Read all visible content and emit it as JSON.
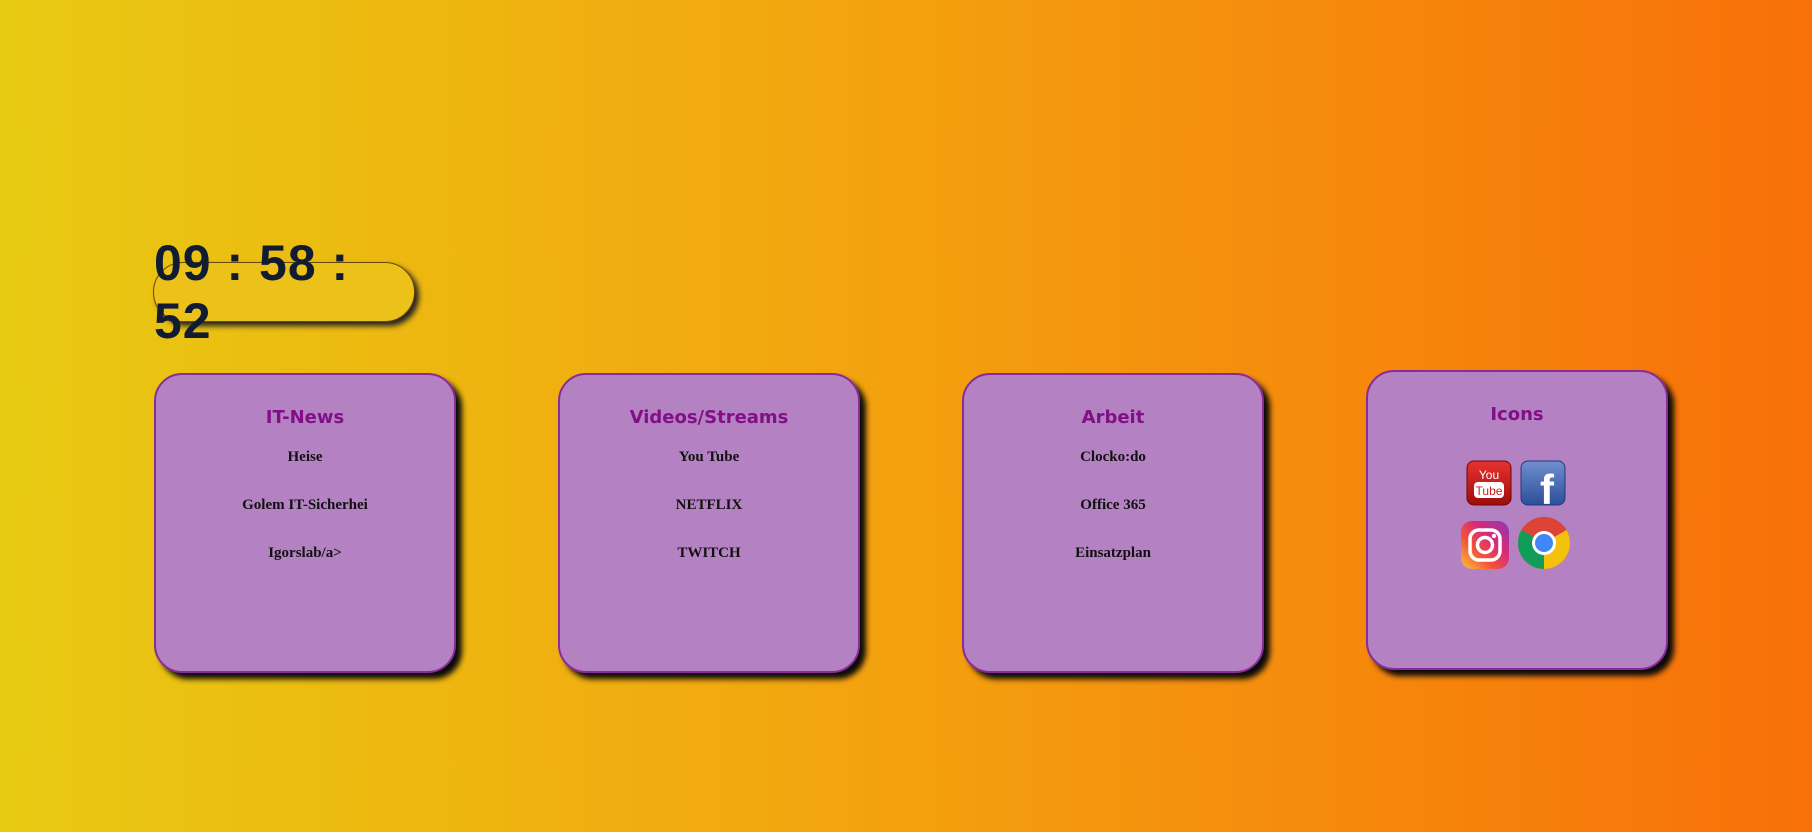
{
  "clock": {
    "time": "09 : 58 : 52"
  },
  "cards": [
    {
      "title": "IT-News",
      "links": [
        "Heise",
        "Golem IT-Sicherhei",
        "Igorslab/a>"
      ]
    },
    {
      "title": "Videos/Streams",
      "links": [
        "You Tube",
        "NETFLIX",
        "TWITCH"
      ]
    },
    {
      "title": "Arbeit",
      "links": [
        "Clocko:do",
        "Office 365",
        "Einsatzplan"
      ]
    },
    {
      "title": "Icons"
    }
  ],
  "icons": [
    "youtube-icon",
    "facebook-icon",
    "instagram-icon",
    "chrome-icon"
  ],
  "icon_text": {
    "youtube_top": "You",
    "youtube_bottom": "Tube",
    "facebook_letter": "f"
  },
  "colors": {
    "background_left": "#e8ca12",
    "background_right": "#f8700a",
    "card_bg": "#b482c2",
    "card_title": "#820f87",
    "clock_bg": "#ecc21a",
    "clock_text": "#111c33"
  }
}
